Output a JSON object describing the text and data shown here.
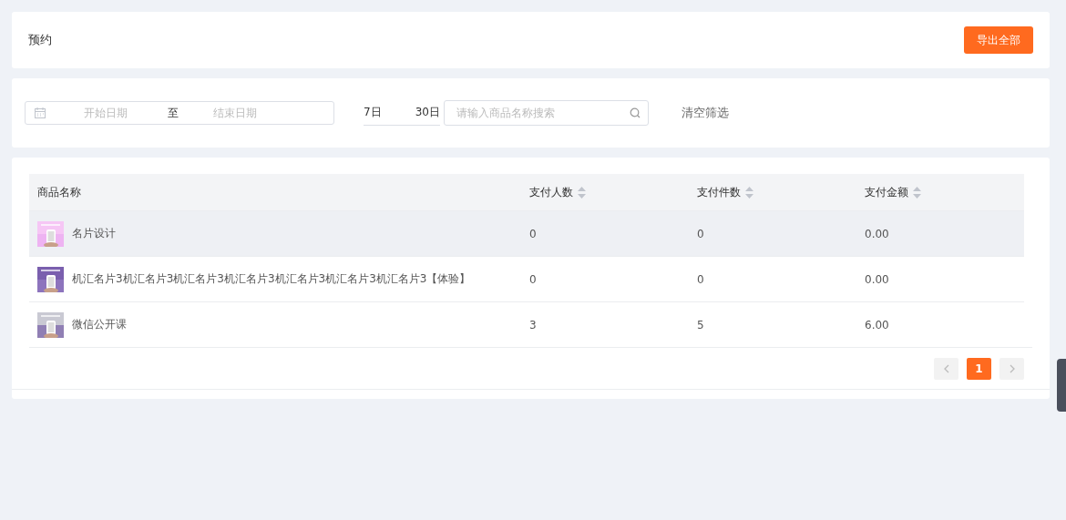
{
  "header": {
    "title": "预约",
    "export_button": "导出全部"
  },
  "filters": {
    "start_placeholder": "开始日期",
    "separator": "至",
    "end_placeholder": "结束日期",
    "quick_ranges": [
      {
        "label": "7日",
        "selected": false
      },
      {
        "label": "30日",
        "selected": false
      }
    ],
    "search_placeholder": "请输入商品名称搜索",
    "clear": "清空筛选"
  },
  "table": {
    "columns": [
      {
        "label": "商品名称",
        "sortable": false
      },
      {
        "label": "支付人数",
        "sortable": true
      },
      {
        "label": "支付件数",
        "sortable": true
      },
      {
        "label": "支付金额",
        "sortable": true
      }
    ],
    "rows": [
      {
        "selected": true,
        "cells": [
          "名片设计",
          "0",
          "0",
          "0.00"
        ]
      },
      {
        "selected": false,
        "cells": [
          "机汇名片3机汇名片3机汇名片3机汇名片3机汇名片3机汇名片3机汇名片3【体验】",
          "0",
          "0",
          "0.00"
        ]
      },
      {
        "selected": false,
        "cells": [
          "微信公开课",
          "3",
          "5",
          "6.00"
        ]
      }
    ]
  },
  "pagination": {
    "pages": [
      {
        "label": "1",
        "selected": true
      }
    ]
  }
}
